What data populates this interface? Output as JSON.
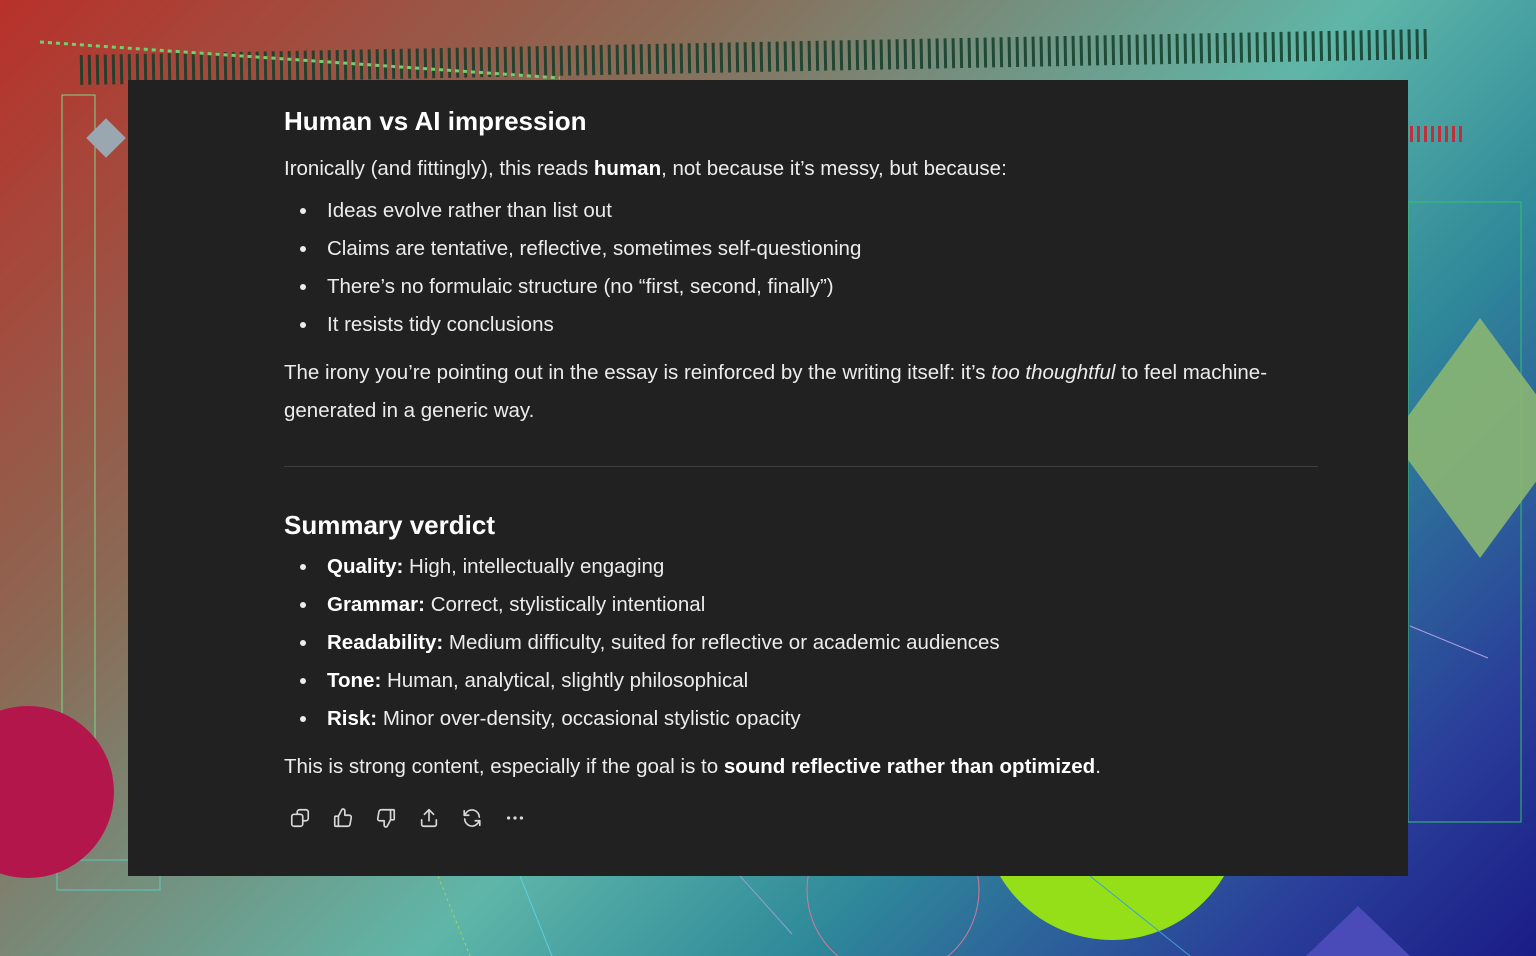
{
  "section1": {
    "heading": "Human vs AI impression",
    "intro_pre": "Ironically (and fittingly), this reads ",
    "intro_bold": "human",
    "intro_post": ", not because it’s messy, but because:",
    "bullets": [
      "Ideas evolve rather than list out",
      "Claims are tentative, reflective, sometimes self-questioning",
      "There’s no formulaic structure (no “first, second, finally”)",
      "It resists tidy conclusions"
    ],
    "closing_pre": "The irony you’re pointing out in the essay is reinforced by the writing itself: it’s ",
    "closing_italic": "too thoughtful",
    "closing_post": " to feel machine-generated in a generic way."
  },
  "section2": {
    "heading": "Summary verdict",
    "items": [
      {
        "label": "Quality:",
        "text": " High, intellectually engaging"
      },
      {
        "label": "Grammar:",
        "text": " Correct, stylistically intentional"
      },
      {
        "label": "Readability:",
        "text": " Medium difficulty, suited for reflective or academic audiences"
      },
      {
        "label": "Tone:",
        "text": " Human, analytical, slightly philosophical"
      },
      {
        "label": "Risk:",
        "text": " Minor over-density, occasional stylistic opacity"
      }
    ],
    "final_pre": "This is strong content, especially if the goal is to ",
    "final_bold": "sound reflective rather than optimized",
    "final_post": "."
  },
  "toolbar": {
    "icons": [
      "copy-icon",
      "thumbs-up-icon",
      "thumbs-down-icon",
      "share-icon",
      "regenerate-icon",
      "more-icon"
    ]
  },
  "colors": {
    "panel_bg": "#212121",
    "text": "#ececec",
    "heading": "#ffffff",
    "divider": "#3d3d3d"
  }
}
